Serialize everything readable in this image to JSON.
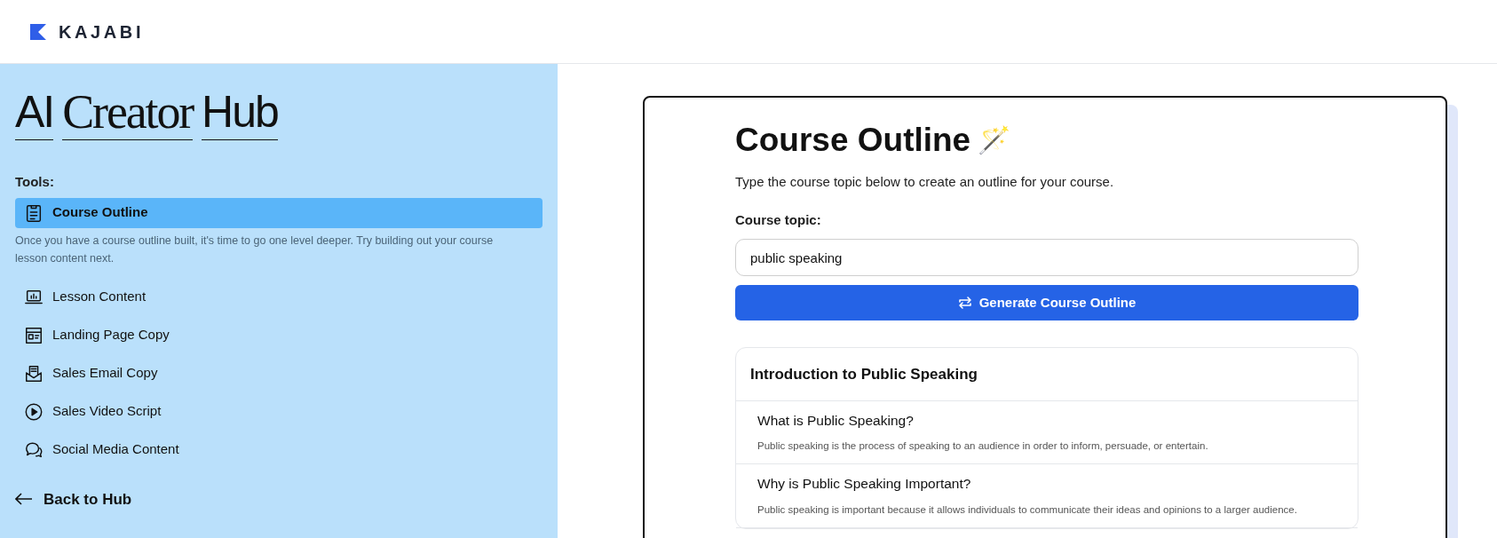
{
  "header": {
    "logo_text": "KAJABI"
  },
  "sidebar": {
    "title_words": [
      {
        "text": "AI",
        "kind": "sans"
      },
      {
        "text": "Creator",
        "kind": "serif"
      },
      {
        "text": "Hub",
        "kind": "sans"
      }
    ],
    "tools_label": "Tools:",
    "items": [
      {
        "label": "Course Outline",
        "selected": true,
        "hint": "Once you have a course outline built, it's time to go one level deeper. Try building out your course lesson content next."
      },
      {
        "label": "Lesson Content",
        "selected": false
      },
      {
        "label": "Landing Page Copy",
        "selected": false
      },
      {
        "label": "Sales Email Copy",
        "selected": false
      },
      {
        "label": "Sales Video Script",
        "selected": false
      },
      {
        "label": "Social Media Content",
        "selected": false
      }
    ],
    "back_link": "Back to Hub"
  },
  "main": {
    "title": "Course Outline",
    "title_emoji": "🪄",
    "description": "Type the course topic below to create an outline for your course.",
    "field_label": "Course topic:",
    "field_value": "public speaking",
    "button": "Generate Course Outline",
    "outline": {
      "heading": "Introduction to Public Speaking",
      "lessons": [
        {
          "title": "What is Public Speaking?",
          "text": "Public speaking is the process of speaking to an audience in order to inform, persuade, or entertain."
        },
        {
          "title": "Why is Public Speaking Important?",
          "text": "Public speaking is important because it allows individuals to communicate their ideas and opinions to a larger audience."
        }
      ]
    }
  }
}
